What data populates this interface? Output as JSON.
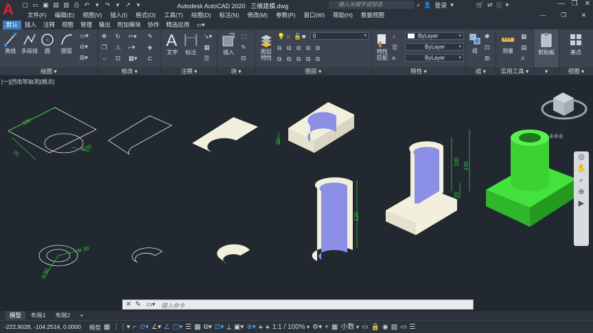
{
  "app": {
    "title": "Autodesk AutoCAD 2020",
    "file": "三维建模.dwg",
    "logo": "A",
    "search_placeholder": "键入关键字或短语",
    "login": "登录"
  },
  "menu": [
    "文件(F)",
    "编辑(E)",
    "视图(V)",
    "插入(I)",
    "格式(O)",
    "工具(T)",
    "绘图(D)",
    "标注(N)",
    "修改(M)",
    "参数(P)",
    "窗口(W)",
    "帮助(H)",
    "数据视图"
  ],
  "tabs": [
    "默认",
    "插入",
    "注释",
    "视图",
    "管理",
    "输出",
    "附加模块",
    "协作",
    "精选应用"
  ],
  "ribbon": {
    "draw": {
      "title": "绘图",
      "line": "直线",
      "polyline": "多段线",
      "circle": "圆",
      "arc": "圆弧"
    },
    "modify": {
      "title": "修改"
    },
    "annotation": {
      "title": "注释",
      "text": "文字",
      "dimension": "标注"
    },
    "block": {
      "title": "块",
      "insert": "插入"
    },
    "layers": {
      "title": "图层",
      "layer_props": "图层\n特性",
      "layer_value": "0"
    },
    "properties": {
      "title": "特性",
      "match": "特性\n匹配",
      "color": "ByLayer",
      "linetype": "ByLayer",
      "lineweight": "ByLayer"
    },
    "groups": {
      "title": "组",
      "group": "组"
    },
    "utilities": {
      "title": "实用工具",
      "measure": "测量"
    },
    "clipboard": {
      "title": "剪贴板",
      "label": "剪贴板"
    },
    "view": {
      "title": "视图",
      "base": "基点"
    }
  },
  "viewport": {
    "label": "[一][西南等轴测][概念]",
    "unnamed": "未命名"
  },
  "dimensions": [
    "100",
    "R30",
    "75",
    "R 30",
    "R30",
    "20",
    "120",
    "100",
    "130",
    "20"
  ],
  "command": {
    "placeholder": "键入命令"
  },
  "layouts": [
    "模型",
    "布局1",
    "布局2"
  ],
  "status": {
    "coords": "-222.9028, -104.2514, 0.0000",
    "model": "模型",
    "scale": "1:1 / 100%",
    "units": "小数"
  },
  "colors": {
    "accent": "#3b7fc4",
    "dim": "#37c837",
    "solid": "#7b7fe0",
    "cylinder": "#44e23c"
  }
}
